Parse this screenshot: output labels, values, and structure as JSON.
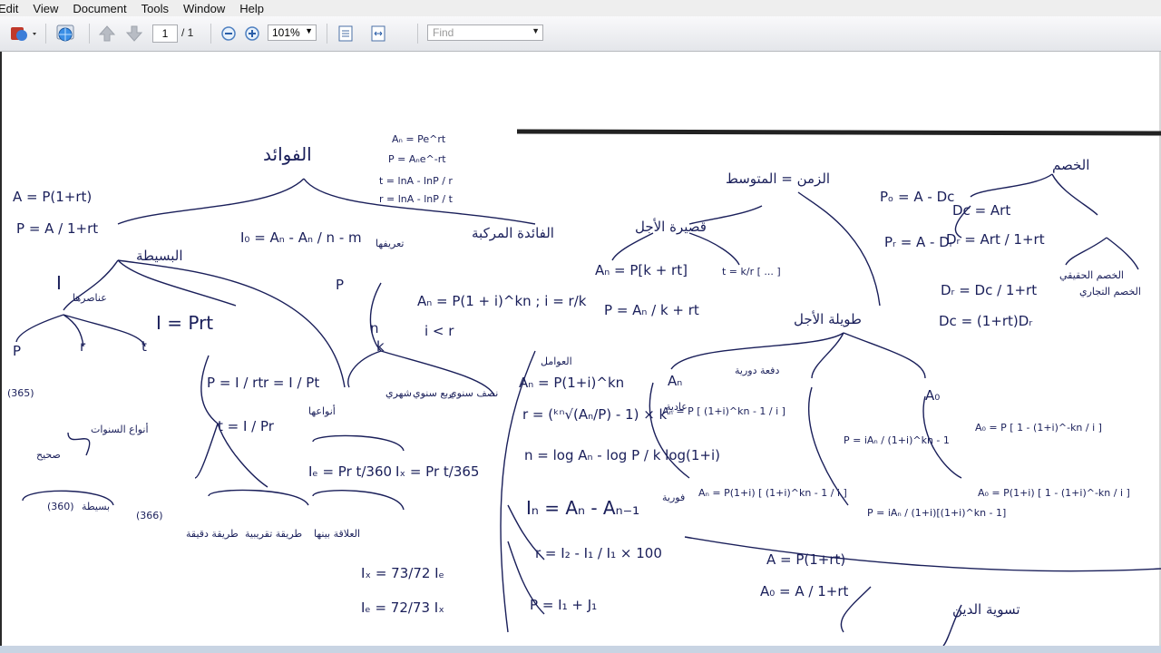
{
  "menu": {
    "edit": "Edit",
    "view": "View",
    "document": "Document",
    "tools": "Tools",
    "window": "Window",
    "help": "Help"
  },
  "toolbar": {
    "page_current": "1",
    "page_total": "/ 1",
    "zoom": "101%",
    "find_placeholder": "Find"
  },
  "icons": {
    "create": "create-pdf-icon",
    "collaborate": "globe-icon",
    "prev": "arrow-up-icon",
    "next": "arrow-down-icon",
    "zoom_out": "zoom-out-icon",
    "zoom_in": "zoom-in-icon",
    "fit_page": "fit-page-icon",
    "fit_width": "fit-width-icon"
  },
  "colors": {
    "ink": "#1a1f5a",
    "toolbar_bg": "#e9ebee",
    "accent": "#2f6fd0"
  },
  "document": {
    "topic_interest": "الفوائد",
    "topic_simple": "البسيطة",
    "topic_compound": "الفائدة المركبة",
    "topic_average_due": "الزمن = المتوسط",
    "topic_discount": "الخصم",
    "topic_short_term": "قصيرة الأجل",
    "topic_long_term": "طويلة الأجل",
    "topic_balance": "تسوية الدين",
    "f_cont1": "Aₙ = Pe^rt",
    "f_cont2": "P = Aₙe^-rt",
    "f_cont3": "t = lnA - lnP / r",
    "f_cont4": "r = lnA - lnP / t",
    "f_simple_a": "A = P(1+rt)",
    "f_simple_p": "P = A / 1+rt",
    "f_io": "I₀ = Aₙ - Aₙ / n - m",
    "f_i_prt": "I = Prt",
    "f_p_irt": "P = I / rt",
    "f_r_ipt": "r = I / Pt",
    "f_t_ipr": "t = I / Pr",
    "f_ie": "Iₑ = Pr t/360",
    "f_ic": "Iₓ = Pr t/365",
    "f_ic_ratio": "Iₓ = 73/72 Iₑ",
    "f_ie_ratio": "Iₑ = 72/73 Iₓ",
    "f_compound": "Aₙ = P(1 + i)^kn ; i = r/k",
    "f_an": "Aₙ = P(1+i)^kn",
    "f_r_comp": "r = (ᵏⁿ√(Aₙ/P) - 1) × k",
    "f_n_log": "n = log Aₙ - log P / k log(1+i)",
    "f_in": "Iₙ = Aₙ - Aₙ₋₁",
    "f_r_rate": "r = I₂ - I₁ / I₁ × 100",
    "f_p_sum": "P = I₁ + J₁",
    "f_avg_a": "Aₙ = P[k + rt]",
    "f_avg_t": "t = k/r [ ... ]",
    "f_avg_p": "P = Aₙ / k + rt",
    "f_pc": "Pₒ = A - Dc",
    "f_dc": "Dc = Art",
    "f_pr": "Pᵣ = A - Dᵣ",
    "f_dr": "Dᵣ = Art / 1+rt",
    "f_dr2": "Dᵣ = Dc / 1+rt",
    "f_dc2": "Dc = (1+rt)Dᵣ",
    "f_annuity_n": "Aₙ = P [ (1+i)^kn - 1 / i ]",
    "f_annuity_a": "A₀ = P [ 1 - (1+i)^-kn / i ]",
    "f_p_ian": "P = iAₙ / (1+i)^kn - 1",
    "f_an_due": "Aₙ = P(1+i) [ (1+i)^kn - 1 / i ]",
    "f_a0_due": "A₀ = P(1+i) [ 1 - (1+i)^-kn / i ]",
    "f_p_due": "P = iAₙ / (1+i)[(1+i)^kn - 1]",
    "f_settle_a": "A = P(1+rt)",
    "f_settle_p": "A₀ = A / 1+rt",
    "label_P": "P",
    "label_I": "I",
    "label_An": "Aₙ",
    "label_A0": "A₀",
    "label_n": "n",
    "label_r": "r",
    "label_k": "k",
    "label_t": "t",
    "label_i_lt_r": "i < r",
    "ar_years": "أنواع السنوات",
    "ar_exact": "صحيح",
    "ar_simple": "بسيطة",
    "ar_n360": "(360)",
    "ar_n365": "(365)",
    "ar_n366": "(366)",
    "ar_ordinary": "عادية",
    "ar_due": "فورية",
    "ar_periodic": "دفعة دورية",
    "ar_elements": "عناصرها",
    "ar_monthly": "شهري",
    "ar_quarterly": "ربع سنوي",
    "ar_semi": "نصف سنوي",
    "ar_relation": "العلاقة بينها",
    "ar_exact_method": "طريقة تقريبية",
    "ar_accurate": "طريقة دقيقة",
    "ar_natural": "الخصم الحقيقي",
    "ar_commercial": "الخصم التجاري",
    "ar_types": "أنواعها",
    "ar_definition": "تعريفها",
    "ar_factors": "العوامل"
  }
}
